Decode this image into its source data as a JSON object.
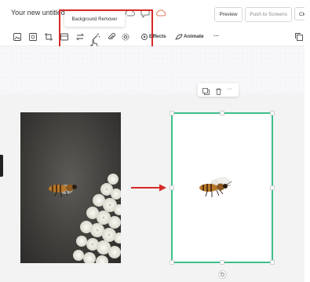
{
  "document": {
    "title": "Your new untitled"
  },
  "header": {
    "preview_label": "Preview",
    "push_label": "Push to Screens",
    "close_label": "Clo"
  },
  "toolbar": {
    "tooltip": "Background Remover",
    "effects_label": "Effects",
    "animate_label": "Animate",
    "more_label": "···"
  },
  "mini_toolbar": {
    "more_label": "···"
  },
  "colors": {
    "highlight": "#d62828",
    "arrow": "#d62828",
    "selection": "#3fbf8a",
    "canvas": "#f3f3f3"
  }
}
